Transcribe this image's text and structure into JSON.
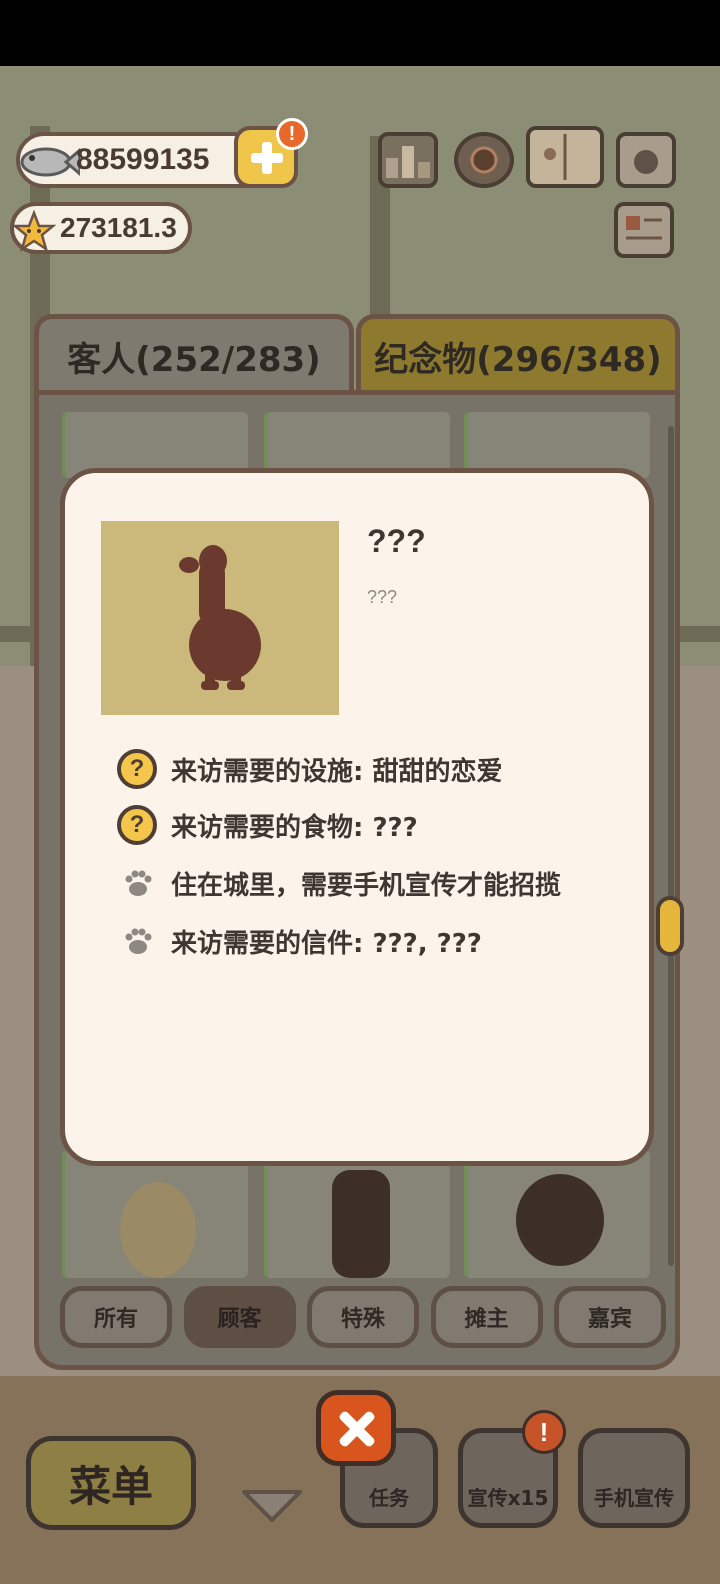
{
  "currency": {
    "fish": "88599135",
    "stars": "273181.3",
    "alert_mark": "!"
  },
  "tabs": {
    "guests": "客人(252/283)",
    "souvenirs": "纪念物(296/348)"
  },
  "dialog": {
    "name": "???",
    "description": "???",
    "requirements": [
      {
        "icon": "question-icon",
        "mark": "?",
        "text": "来访需要的设施: 甜甜的恋爱"
      },
      {
        "icon": "question-icon",
        "mark": "?",
        "text": "来访需要的食物: ???"
      },
      {
        "icon": "paw-icon",
        "text": "住在城里，需要手机宣传才能招揽"
      },
      {
        "icon": "paw-icon",
        "text": "来访需要的信件: ???, ???"
      }
    ]
  },
  "filters": [
    "所有",
    "顾客",
    "特殊",
    "摊主",
    "嘉宾"
  ],
  "active_filter": "顾客",
  "bottom_bar": {
    "menu": "菜单",
    "tasks": "任务",
    "promo_x15": "宣传x15",
    "phone_promo": "手机宣传"
  },
  "colors": {
    "accent_yellow": "#f4c64b",
    "close_orange": "#d8551e",
    "silhouette": "#6b3a2e",
    "dialog_bg": "#fcf4eb"
  }
}
